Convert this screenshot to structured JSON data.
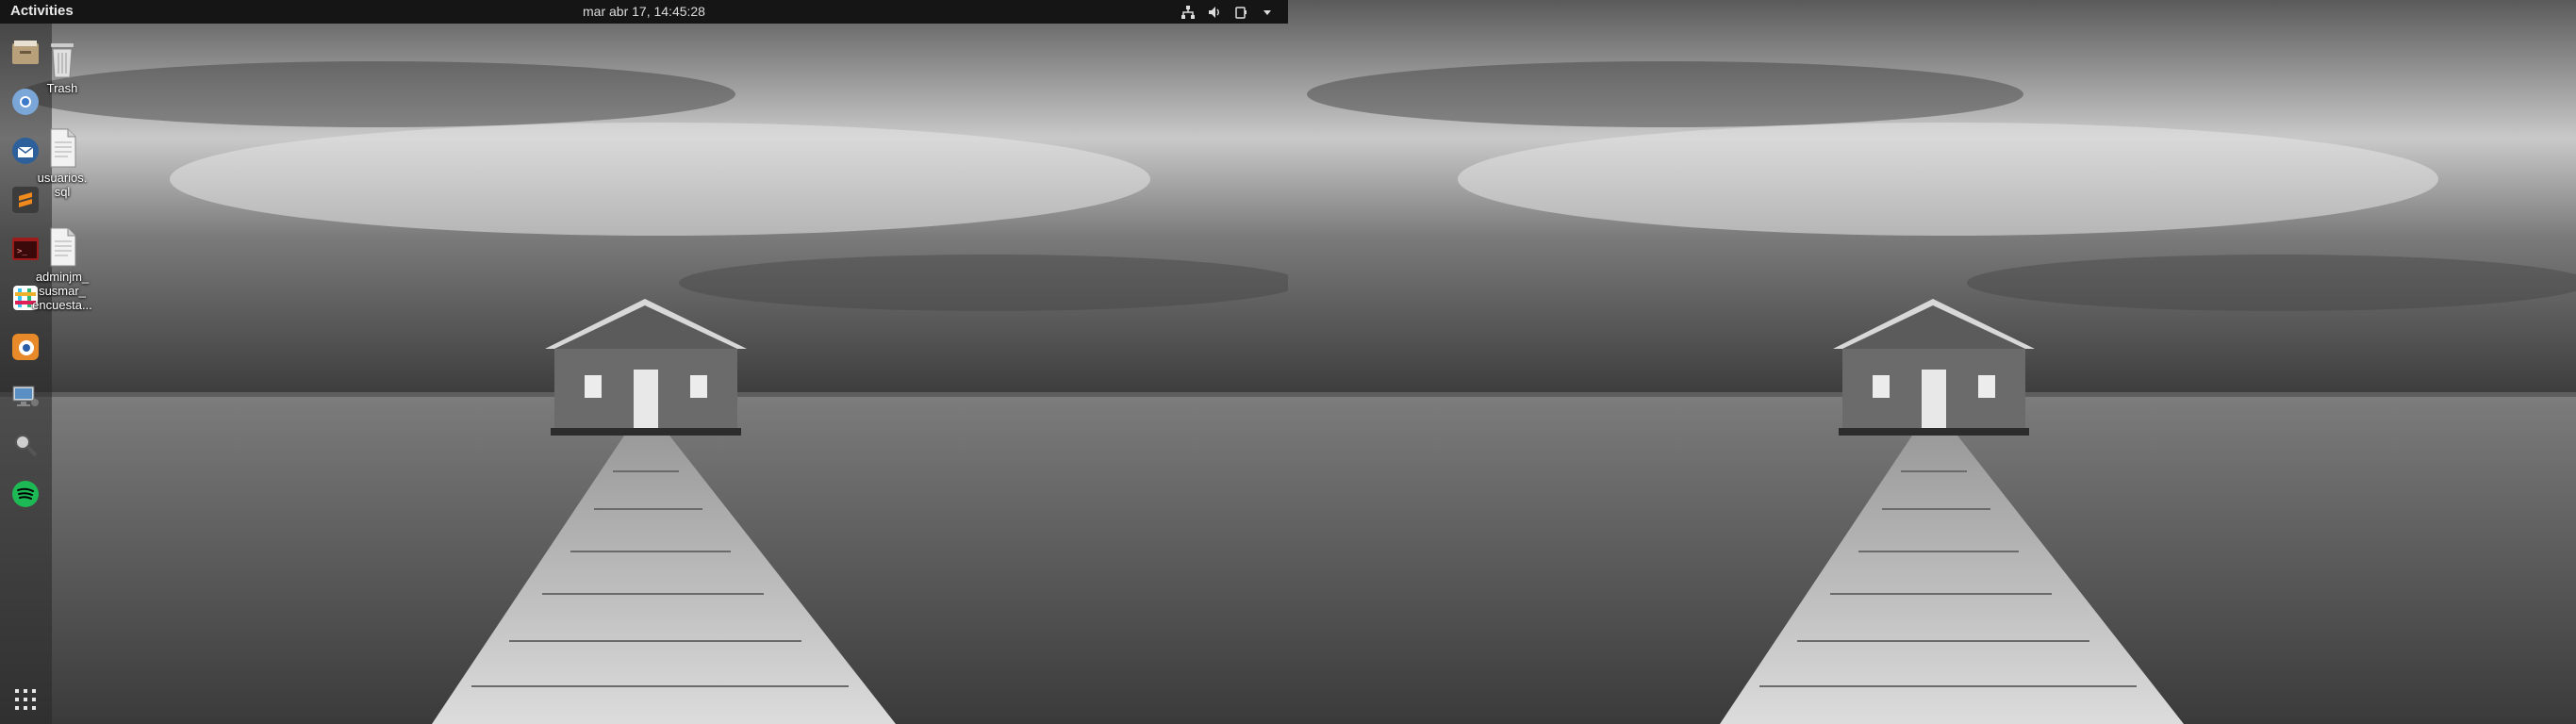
{
  "topbar": {
    "activities_label": "Activities",
    "clock": "mar abr 17, 14:45:28",
    "tray": [
      "network-icon",
      "volume-icon",
      "power-icon",
      "chevron-down-icon"
    ]
  },
  "dock": {
    "items": [
      {
        "name": "files-icon"
      },
      {
        "name": "chromium-icon"
      },
      {
        "name": "thunderbird-icon"
      },
      {
        "name": "sublime-text-icon"
      },
      {
        "name": "terminal-app-icon"
      },
      {
        "name": "slack-icon"
      },
      {
        "name": "blender-icon"
      },
      {
        "name": "remote-desktop-icon"
      },
      {
        "name": "search-tool-icon"
      },
      {
        "name": "spotify-icon"
      }
    ],
    "show_apps": "apps-grid-icon"
  },
  "desktop": {
    "icons": [
      {
        "label": "Trash"
      },
      {
        "label": "usuarios.\nsql"
      },
      {
        "label": "adminjm_\nsusmar_\nencuesta..."
      }
    ]
  },
  "colors": {
    "topbar": "#151515",
    "dock": "#282828",
    "spotify": "#1db954",
    "sublime": "#f08a1c"
  }
}
